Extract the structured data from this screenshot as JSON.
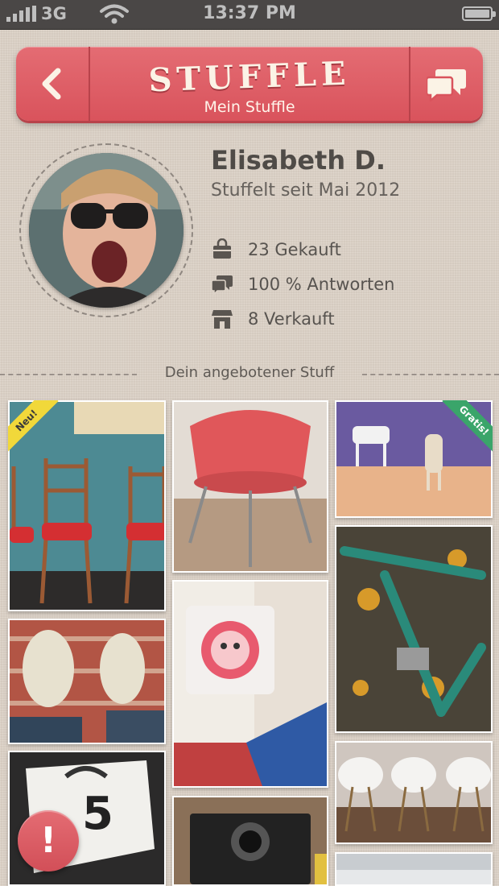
{
  "status_bar": {
    "carrier": "3G",
    "time": "13:37 PM"
  },
  "header": {
    "logo": "STUFFLE",
    "subtitle": "Mein Stuffle"
  },
  "profile": {
    "name": "Elisabeth D.",
    "since": "Stuffelt seit Mai 2012",
    "stats": [
      {
        "icon": "shopping-bag-icon",
        "label": "23 Gekauft"
      },
      {
        "icon": "chat-bubbles-icon",
        "label": "100 % Antworten"
      },
      {
        "icon": "store-icon",
        "label": "8 Verkauft"
      }
    ]
  },
  "section": {
    "title": "Dein angebotener Stuff"
  },
  "items": [
    {
      "name": "red-chairs-item",
      "badge": "Neu!"
    },
    {
      "name": "pink-lounge-chair-item",
      "badge": ""
    },
    {
      "name": "horse-figurines-item",
      "badge": "Gratis!"
    },
    {
      "name": "green-bicycle-item",
      "badge": ""
    },
    {
      "name": "white-shoes-item",
      "badge": ""
    },
    {
      "name": "sun-pillow-item",
      "badge": ""
    },
    {
      "name": "white-chairs-item",
      "badge": ""
    },
    {
      "name": "bmx-number-plate-item",
      "badge": ""
    },
    {
      "name": "polaroid-camera-item",
      "badge": ""
    },
    {
      "name": "misc-item",
      "badge": ""
    }
  ],
  "alert": {
    "label": "!"
  }
}
